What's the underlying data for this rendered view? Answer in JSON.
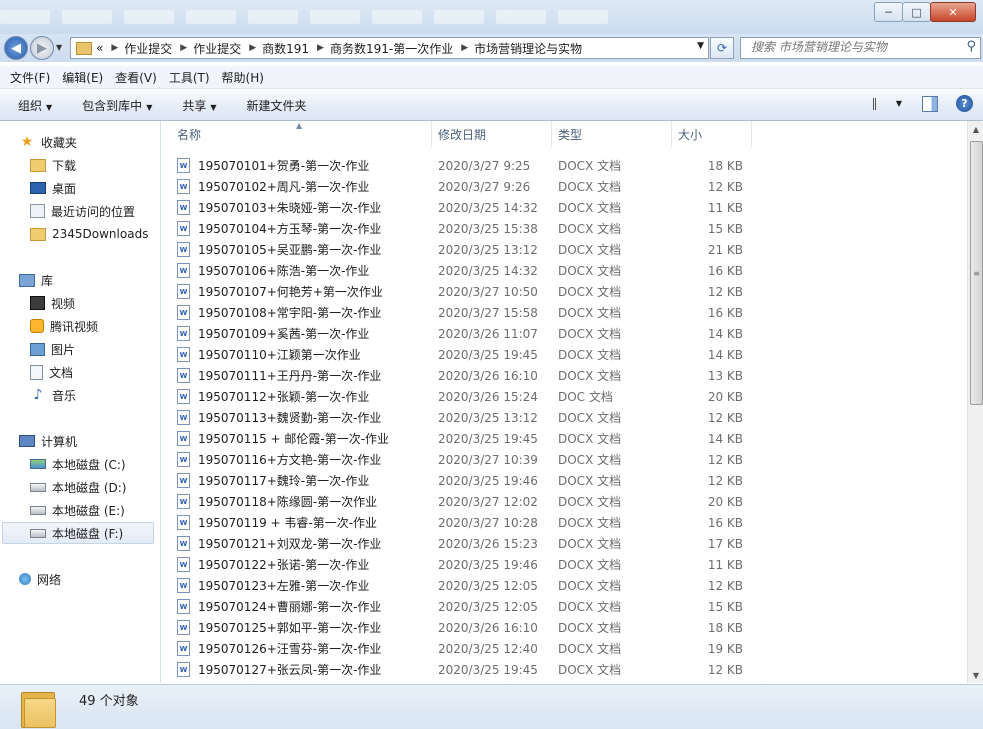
{
  "window": {
    "minimize_label": "─",
    "maximize_label": "□",
    "close_label": "✕"
  },
  "address": {
    "crumbs": [
      "«",
      "作业提交",
      "作业提交",
      "商数191",
      "商务数191-第一次作业",
      "市场营销理论与实物"
    ]
  },
  "search": {
    "placeholder": "搜索 市场营销理论与实物"
  },
  "menu": [
    "文件(F)",
    "编辑(E)",
    "查看(V)",
    "工具(T)",
    "帮助(H)"
  ],
  "toolbar": {
    "organize": "组织",
    "include": "包含到库中",
    "share": "共享",
    "new_folder": "新建文件夹"
  },
  "nav": {
    "favorites": "收藏夹",
    "fav_items": [
      "下载",
      "桌面",
      "最近访问的位置",
      "2345Downloads"
    ],
    "libraries": "库",
    "lib_items": [
      "视频",
      "腾讯视频",
      "图片",
      "文档",
      "音乐"
    ],
    "computer": "计算机",
    "drives": [
      "本地磁盘 (C:)",
      "本地磁盘 (D:)",
      "本地磁盘 (E:)",
      "本地磁盘 (F:)"
    ],
    "network": "网络"
  },
  "columns": {
    "name": "名称",
    "date": "修改日期",
    "type": "类型",
    "size": "大小"
  },
  "files": [
    {
      "name": "195070101+贺勇-第一次-作业",
      "date": "2020/3/27 9:25",
      "type": "DOCX 文档",
      "size": "18 KB"
    },
    {
      "name": "195070102+周凡-第一次-作业",
      "date": "2020/3/27 9:26",
      "type": "DOCX 文档",
      "size": "12 KB"
    },
    {
      "name": "195070103+朱晓娅-第一次-作业",
      "date": "2020/3/25 14:32",
      "type": "DOCX 文档",
      "size": "11 KB"
    },
    {
      "name": "195070104+方玉琴-第一次-作业",
      "date": "2020/3/25 15:38",
      "type": "DOCX 文档",
      "size": "15 KB"
    },
    {
      "name": "195070105+吴亚鹏-第一次-作业",
      "date": "2020/3/25 13:12",
      "type": "DOCX 文档",
      "size": "21 KB"
    },
    {
      "name": "195070106+陈浩-第一次-作业",
      "date": "2020/3/25 14:32",
      "type": "DOCX 文档",
      "size": "16 KB"
    },
    {
      "name": "195070107+何艳芳+第一次作业",
      "date": "2020/3/27 10:50",
      "type": "DOCX 文档",
      "size": "12 KB"
    },
    {
      "name": "195070108+常宇阳-第一次-作业",
      "date": "2020/3/27 15:58",
      "type": "DOCX 文档",
      "size": "16 KB"
    },
    {
      "name": "195070109+奚茜-第一次-作业",
      "date": "2020/3/26 11:07",
      "type": "DOCX 文档",
      "size": "14 KB"
    },
    {
      "name": "195070110+江颖第一次作业",
      "date": "2020/3/25 19:45",
      "type": "DOCX 文档",
      "size": "14 KB"
    },
    {
      "name": "195070111+王丹丹-第一次-作业",
      "date": "2020/3/26 16:10",
      "type": "DOCX 文档",
      "size": "13 KB"
    },
    {
      "name": "195070112+张颖-第一次-作业",
      "date": "2020/3/26 15:24",
      "type": "DOC 文档",
      "size": "20 KB"
    },
    {
      "name": "195070113+魏贤勤-第一次-作业",
      "date": "2020/3/25 13:12",
      "type": "DOCX 文档",
      "size": "12 KB"
    },
    {
      "name": "195070115 + 邮伦霞-第一次-作业",
      "date": "2020/3/25 19:45",
      "type": "DOCX 文档",
      "size": "14 KB"
    },
    {
      "name": "195070116+方文艳-第一次-作业",
      "date": "2020/3/27 10:39",
      "type": "DOCX 文档",
      "size": "12 KB"
    },
    {
      "name": "195070117+魏玲-第一次-作业",
      "date": "2020/3/25 19:46",
      "type": "DOCX 文档",
      "size": "12 KB"
    },
    {
      "name": "195070118+陈缘圆-第一次作业",
      "date": "2020/3/27 12:02",
      "type": "DOCX 文档",
      "size": "20 KB"
    },
    {
      "name": "195070119 + 韦睿-第一次-作业",
      "date": "2020/3/27 10:28",
      "type": "DOCX 文档",
      "size": "16 KB"
    },
    {
      "name": "195070121+刘双龙-第一次-作业",
      "date": "2020/3/26 15:23",
      "type": "DOCX 文档",
      "size": "17 KB"
    },
    {
      "name": "195070122+张诺-第一次-作业",
      "date": "2020/3/25 19:46",
      "type": "DOCX 文档",
      "size": "11 KB"
    },
    {
      "name": "195070123+左雅-第一次-作业",
      "date": "2020/3/25 12:05",
      "type": "DOCX 文档",
      "size": "12 KB"
    },
    {
      "name": "195070124+曹丽娜-第一次-作业",
      "date": "2020/3/25 12:05",
      "type": "DOCX 文档",
      "size": "15 KB"
    },
    {
      "name": "195070125+郭如平-第一次-作业",
      "date": "2020/3/26 16:10",
      "type": "DOCX 文档",
      "size": "18 KB"
    },
    {
      "name": "195070126+汪雪芬-第一次-作业",
      "date": "2020/3/25 12:40",
      "type": "DOCX 文档",
      "size": "19 KB"
    },
    {
      "name": "195070127+张云凤-第一次-作业",
      "date": "2020/3/25 19:45",
      "type": "DOCX 文档",
      "size": "12 KB"
    }
  ],
  "status": {
    "count": "49 个对象"
  }
}
